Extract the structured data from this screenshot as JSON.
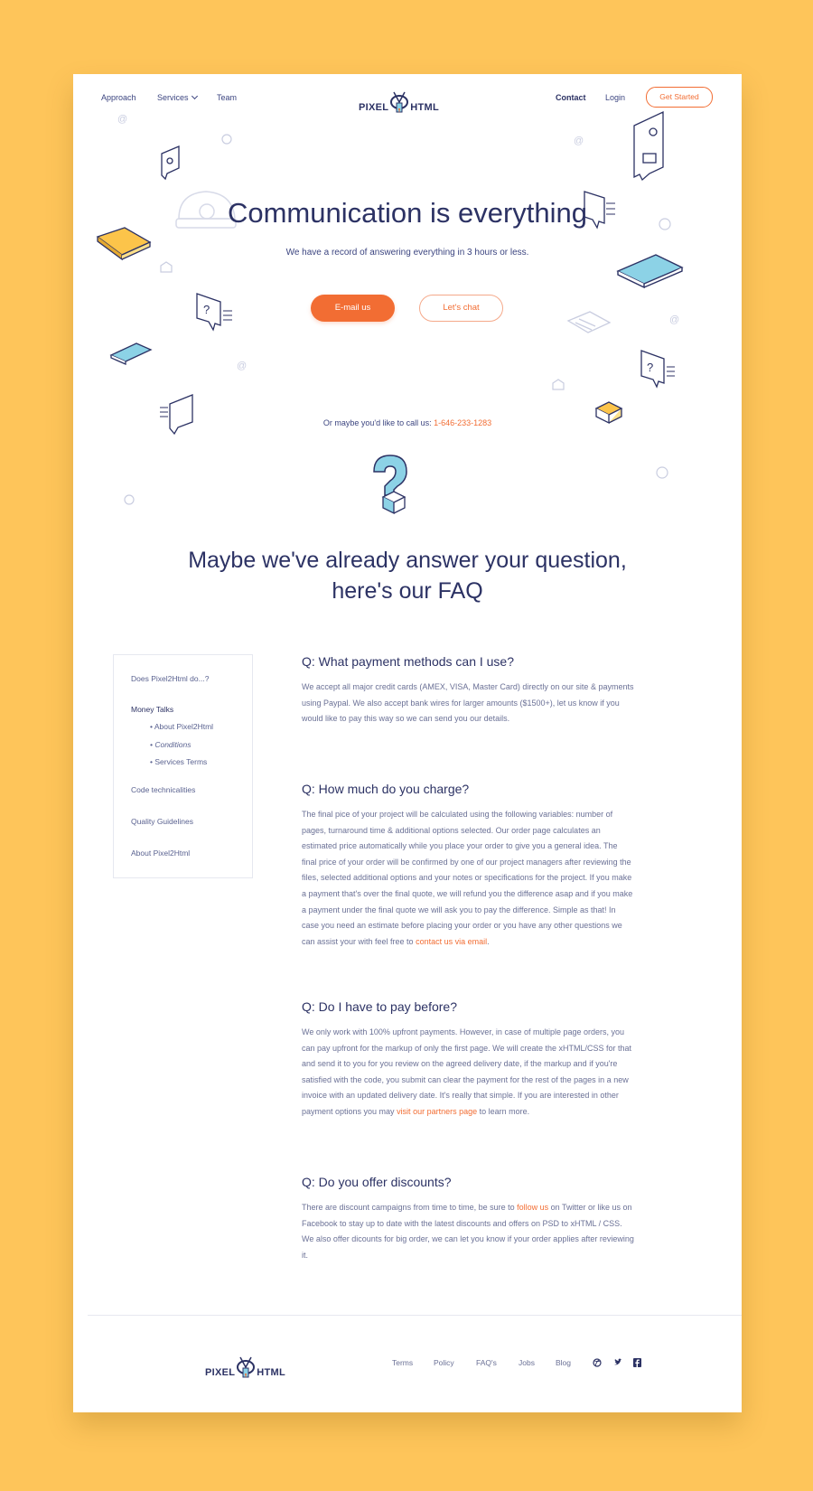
{
  "nav": {
    "approach": "Approach",
    "services": "Services",
    "team": "Team",
    "contact": "Contact",
    "login": "Login",
    "get_started": "Get Started"
  },
  "logo": {
    "left": "PIXEL",
    "right": "HTML"
  },
  "hero": {
    "title": "Communication is everything",
    "subtitle": "We have a record of answering everything in 3 hours or less.",
    "email_button": "E-mail us",
    "chat_button": "Let's chat",
    "call_text": "Or maybe you'd like to call us: ",
    "phone": "1-646-233-1283"
  },
  "faq": {
    "title_line1": "Maybe we've already answer your question,",
    "title_line2": "here's our FAQ"
  },
  "sidebar": {
    "items": [
      "Does Pixel2Html do...?",
      "Money Talks",
      "Code technicalities",
      "Quality Guidelines",
      "About Pixel2Html"
    ],
    "subitems": [
      "• About Pixel2Html",
      "• Conditions",
      "• Services Terms"
    ]
  },
  "questions": [
    {
      "q": "Q: What payment methods can I use?",
      "a": "We accept all major credit cards (AMEX, VISA, Master Card) directly on our site & payments using Paypal. We also accept bank wires for larger amounts ($1500+), let us know if you would like to pay this way so we can send you our details."
    },
    {
      "q": "Q: How much do you charge?",
      "a": "The final pice of your project will be calculated using the following variables: number of pages, turnaround time & additional options selected. Our order page calculates an estimated price automatically while you place your order to give you a general idea. The final price of your order will be confirmed by one of our project managers after reviewing the files, selected additional options and your notes or specifications for the project. If you make a payment that's over the final quote, we will refund you the difference asap and if you make a payment under the final quote we will ask you to pay the difference. Simple as that! In case you need an estimate before placing your order or you have any other questions we can assist your with feel free to ",
      "link": "contact us via email",
      "tail": "."
    },
    {
      "q": "Q: Do I have to pay before?",
      "a": "We only work with 100% upfront payments. However, in case of multiple page orders, you can pay upfront for the markup of only the first page. We will create the xHTML/CSS for that and send it to you for you review on the agreed delivery date, if the markup and if you're satisfied with the code, you submit can clear the payment for the rest of the pages in a new invoice with an updated delivery date. It's really that simple. If you are interested in other payment options you may ",
      "link": "visit our partners page",
      "tail": " to learn more."
    },
    {
      "q": "Q: Do you offer discounts?",
      "a": "There are discount campaigns from time to time, be sure to ",
      "link": "follow us",
      "tail": " on Twitter or like us on Facebook to stay up to date with the latest discounts and offers on PSD to xHTML / CSS. We also offer dicounts for big order, we can let you know if your order applies after reviewing it."
    }
  ],
  "footer": {
    "links": [
      "Terms",
      "Policy",
      "FAQ's",
      "Jobs",
      "Blog"
    ],
    "social_icons": [
      "dribbble-icon",
      "twitter-icon",
      "facebook-icon"
    ]
  },
  "colors": {
    "background": "#fec55a",
    "accent": "#f26d33",
    "navy": "#2c3264",
    "text": "#6b7196"
  }
}
